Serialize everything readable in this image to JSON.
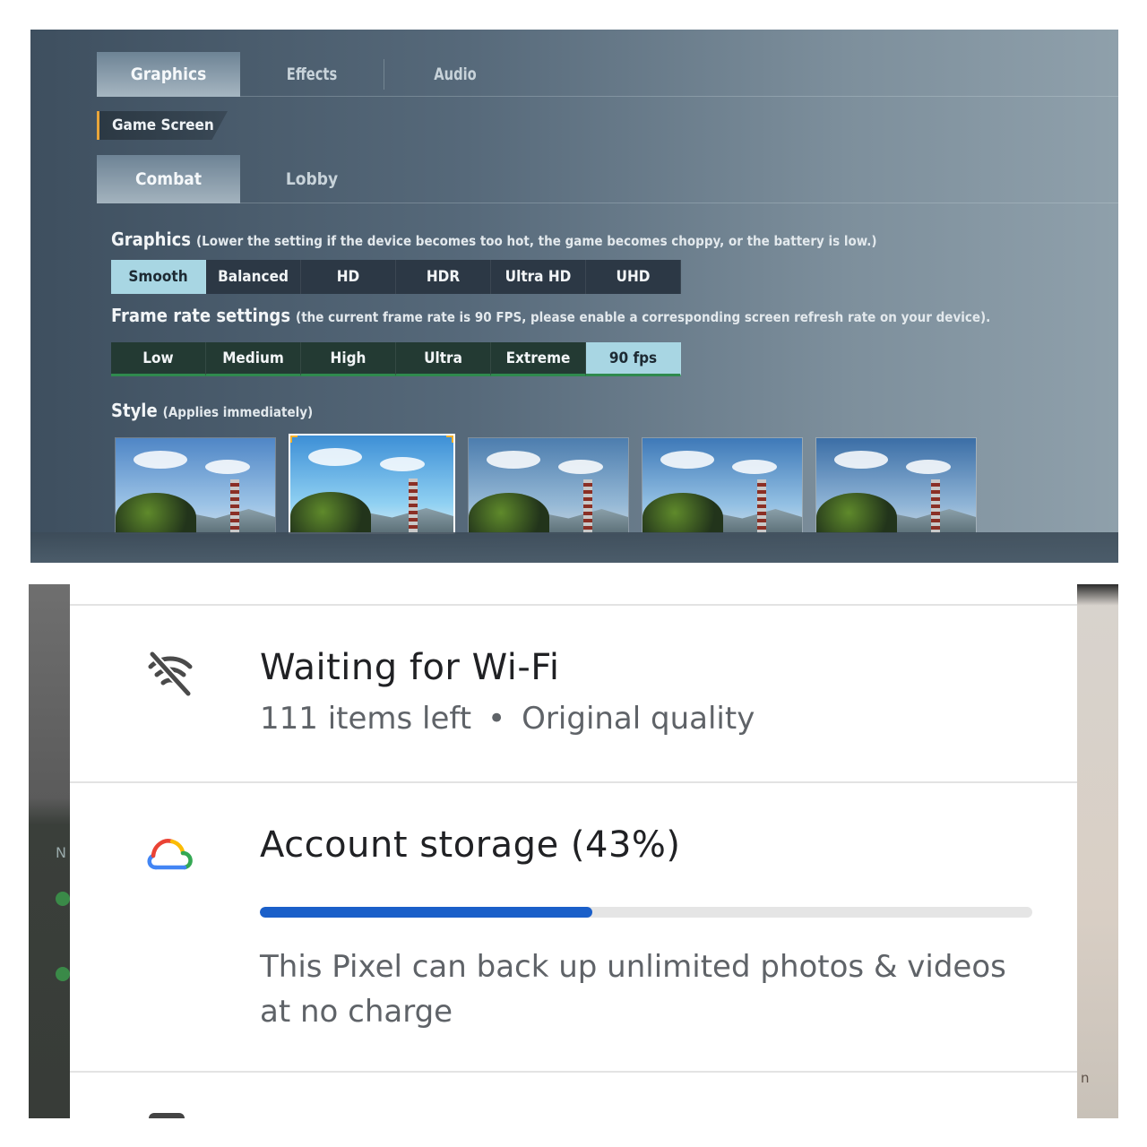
{
  "game": {
    "tabs": [
      {
        "label": "Graphics",
        "active": true
      },
      {
        "label": "Effects",
        "active": false
      },
      {
        "label": "Audio",
        "active": false
      }
    ],
    "section_label": "Game Screen",
    "subtabs": [
      {
        "label": "Combat",
        "active": true
      },
      {
        "label": "Lobby",
        "active": false
      }
    ],
    "graphics": {
      "title": "Graphics",
      "note": "(Lower the setting if the device becomes too hot, the game becomes choppy, or the battery is low.)",
      "options": [
        "Smooth",
        "Balanced",
        "HD",
        "HDR",
        "Ultra HD",
        "UHD"
      ],
      "selected": "Smooth"
    },
    "frame_rate": {
      "title": "Frame rate settings",
      "note": "(the current frame rate is 90 FPS, please enable a corresponding screen refresh rate on your device).",
      "options": [
        "Low",
        "Medium",
        "High",
        "Ultra",
        "Extreme",
        "90 fps"
      ],
      "selected": "90 fps"
    },
    "style": {
      "title": "Style",
      "note": "(Applies immediately)",
      "thumbnail_count": 5,
      "selected_index": 1
    },
    "colors": {
      "selected_option": "#a8d6e3",
      "fps_underline": "#2f8a4e",
      "section_accent": "#e8a53a"
    }
  },
  "photos": {
    "wifi": {
      "icon": "wifi-off-icon",
      "title": "Waiting for Wi-Fi",
      "items_left": "111 items left",
      "separator": "•",
      "quality": "Original quality"
    },
    "storage": {
      "icon": "google-cloud-icon",
      "title": "Account storage (43%)",
      "percent": 43,
      "description": "This Pixel can back up unlimited photos & videos at no charge"
    },
    "colors": {
      "progress_fill": "#1a5fc9",
      "progress_track": "#e5e5e5"
    }
  }
}
